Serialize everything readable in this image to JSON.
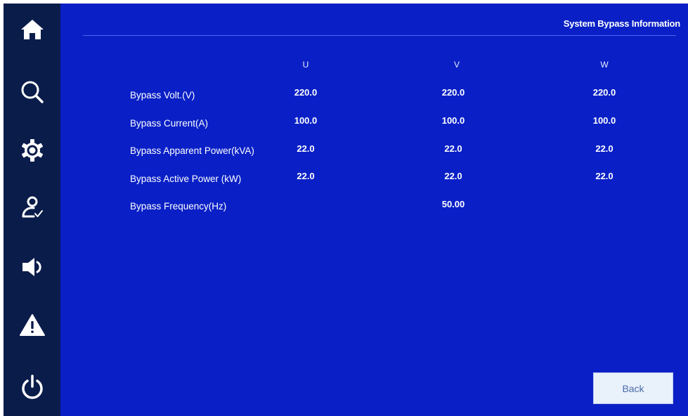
{
  "header": {
    "title": "System Bypass Information"
  },
  "sidebar": {
    "items": [
      {
        "icon": "home-icon"
      },
      {
        "icon": "search-icon"
      },
      {
        "icon": "gear-icon"
      },
      {
        "icon": "user-check-icon"
      },
      {
        "icon": "speaker-icon"
      },
      {
        "icon": "warning-icon"
      },
      {
        "icon": "power-icon"
      }
    ]
  },
  "table": {
    "columns": [
      "U",
      "V",
      "W"
    ],
    "rows": [
      {
        "label": "Bypass Volt.(V)",
        "values": [
          "220.0",
          "220.0",
          "220.0"
        ]
      },
      {
        "label": "Bypass Current(A)",
        "values": [
          "100.0",
          "100.0",
          "100.0"
        ]
      },
      {
        "label": "Bypass Apparent Power(kVA)",
        "values": [
          "22.0",
          "22.0",
          "22.0"
        ]
      },
      {
        "label": "Bypass Active Power (kW)",
        "values": [
          "22.0",
          "22.0",
          "22.0"
        ]
      },
      {
        "label": "Bypass Frequency(Hz)",
        "value": "50.00"
      }
    ]
  },
  "actions": {
    "back_label": "Back"
  },
  "colors": {
    "background": "#0a20c6",
    "sidebar": "#0a1c4a",
    "button": "#e9f1fb"
  }
}
